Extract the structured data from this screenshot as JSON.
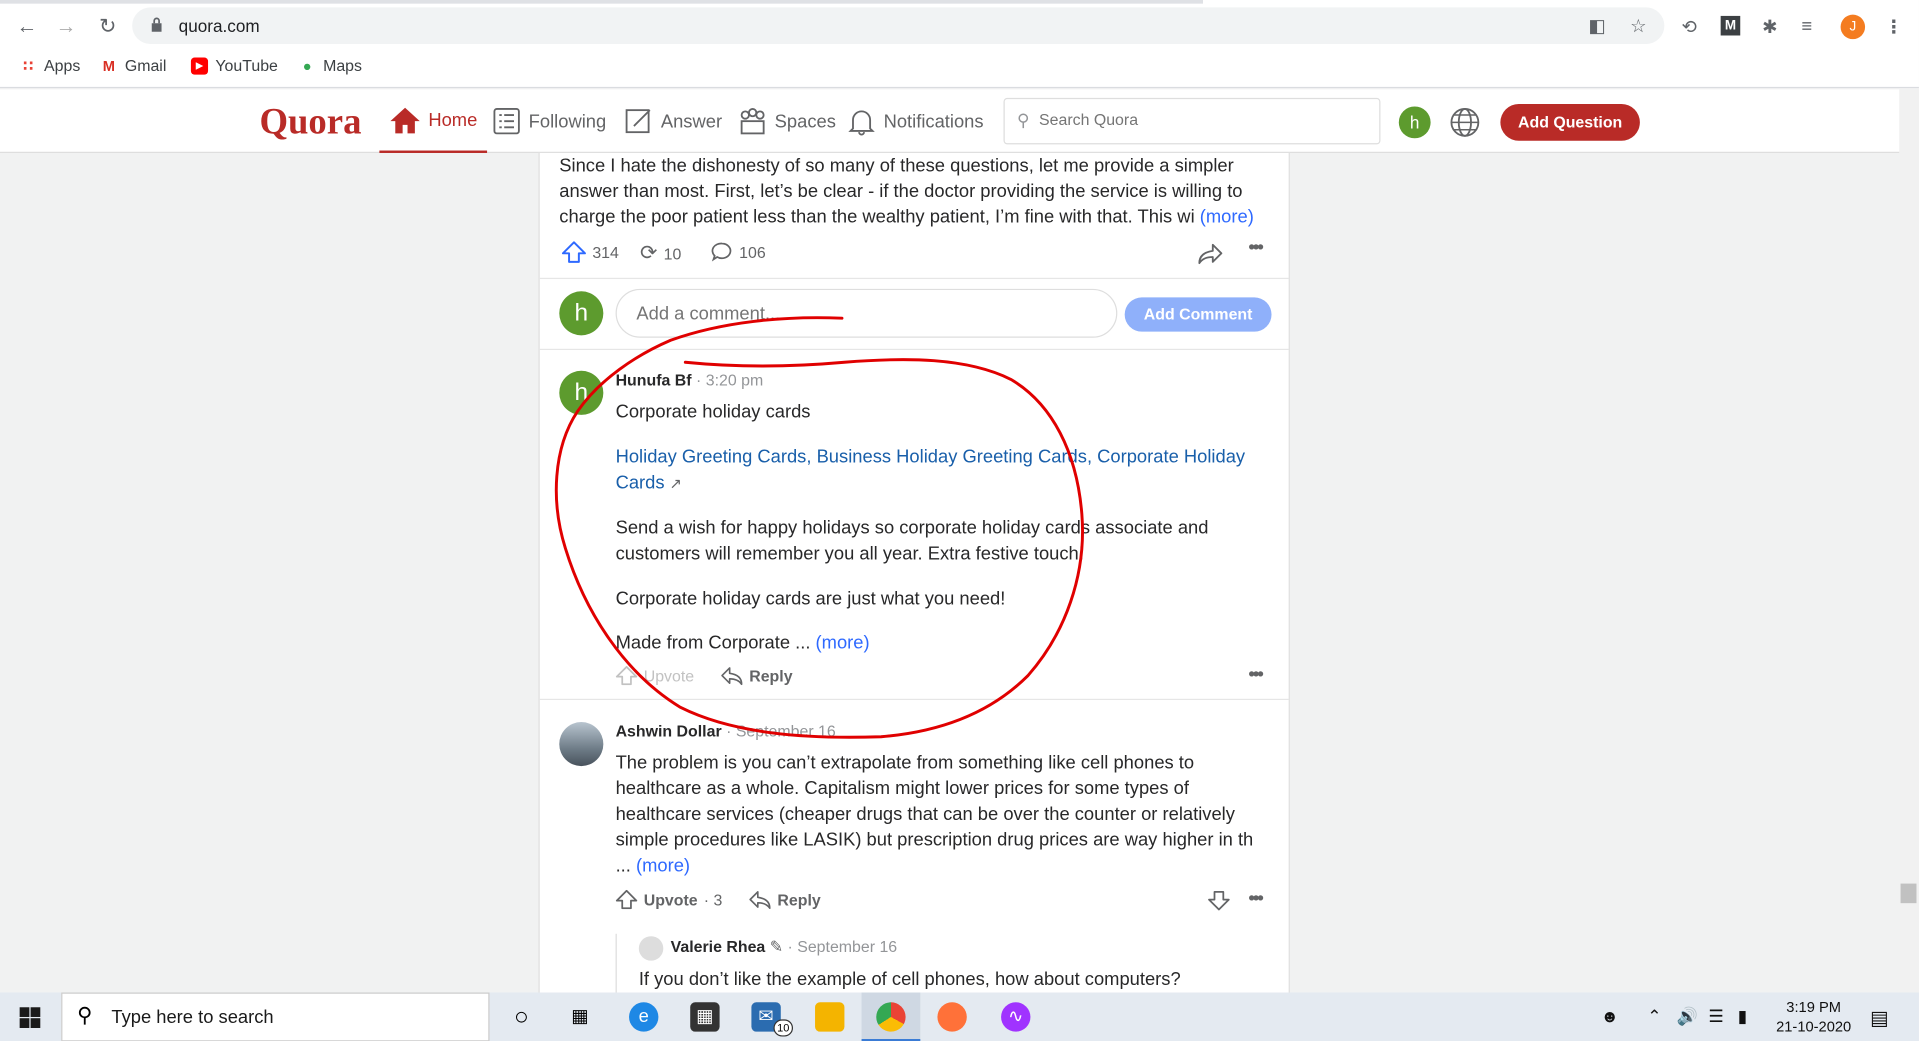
{
  "browser": {
    "url": "quora.com",
    "profile_initial": "J",
    "bookmarks": [
      {
        "label": "Apps",
        "icon": "apps-grid-icon"
      },
      {
        "label": "Gmail",
        "icon": "gmail-icon"
      },
      {
        "label": "YouTube",
        "icon": "youtube-icon"
      },
      {
        "label": "Maps",
        "icon": "maps-icon"
      }
    ]
  },
  "quora": {
    "logo": "Quora",
    "nav": [
      {
        "label": "Home",
        "icon": "home-icon",
        "active": true
      },
      {
        "label": "Following",
        "icon": "following-icon"
      },
      {
        "label": "Answer",
        "icon": "answer-icon"
      },
      {
        "label": "Spaces",
        "icon": "spaces-icon"
      },
      {
        "label": "Notifications",
        "icon": "bell-icon"
      }
    ],
    "search_placeholder": "Search Quora",
    "user_initial": "h",
    "add_question": "Add Question"
  },
  "answer": {
    "text": "Since I hate the dishonesty of so many of these questions, let me provide a simpler answer than most. First, let’s be clear - if the doctor providing the service is willing to charge the poor patient less than the wealthy patient, I’m fine with that. This wi",
    "more": "(more)",
    "upvotes": "314",
    "shares": "10",
    "comments": "106"
  },
  "comment_input": {
    "avatar": "h",
    "placeholder": "Add a comment...",
    "button": "Add Comment"
  },
  "comments": [
    {
      "avatar": "h",
      "author": "Hunufa Bf",
      "time": "· 3:20 pm",
      "title": "Corporate holiday cards",
      "link": "Holiday Greeting Cards, Business Holiday Greeting Cards, Corporate Holiday Cards",
      "para1": "Send a wish for happy holidays so corporate holiday cards associate and customers will remember you all year. Extra festive touch!",
      "para2": "Corporate holiday cards are just what you need!",
      "para3": "Made from Corporate ...",
      "more": "(more)",
      "upvote": "Upvote",
      "reply": "Reply"
    },
    {
      "author": "Ashwin Dollar",
      "time": "· September 16",
      "body": "The problem is you can’t extrapolate from something like cell phones to healthcare as a whole. Capitalism might lower prices for some types of healthcare services (cheaper drugs that can be over the counter or relatively simple procedures like LASIK) but prescription drug prices are way higher in th",
      "ellipsis": "...",
      "more": "(more)",
      "upvote": "Upvote",
      "upvote_count": "· 3",
      "reply": "Reply"
    },
    {
      "author": "Valerie Rhea",
      "time": "· September 16",
      "body": "If you don’t like the example of cell phones, how about computers?"
    }
  ],
  "taskbar": {
    "search_placeholder": "Type here to search",
    "mail_badge": "10",
    "time": "3:19 PM",
    "date": "21-10-2020"
  },
  "colors": {
    "quora_red": "#b92b27",
    "link_blue": "#195faa",
    "more_blue": "#2e69ff",
    "annotation_red": "#e00000"
  }
}
